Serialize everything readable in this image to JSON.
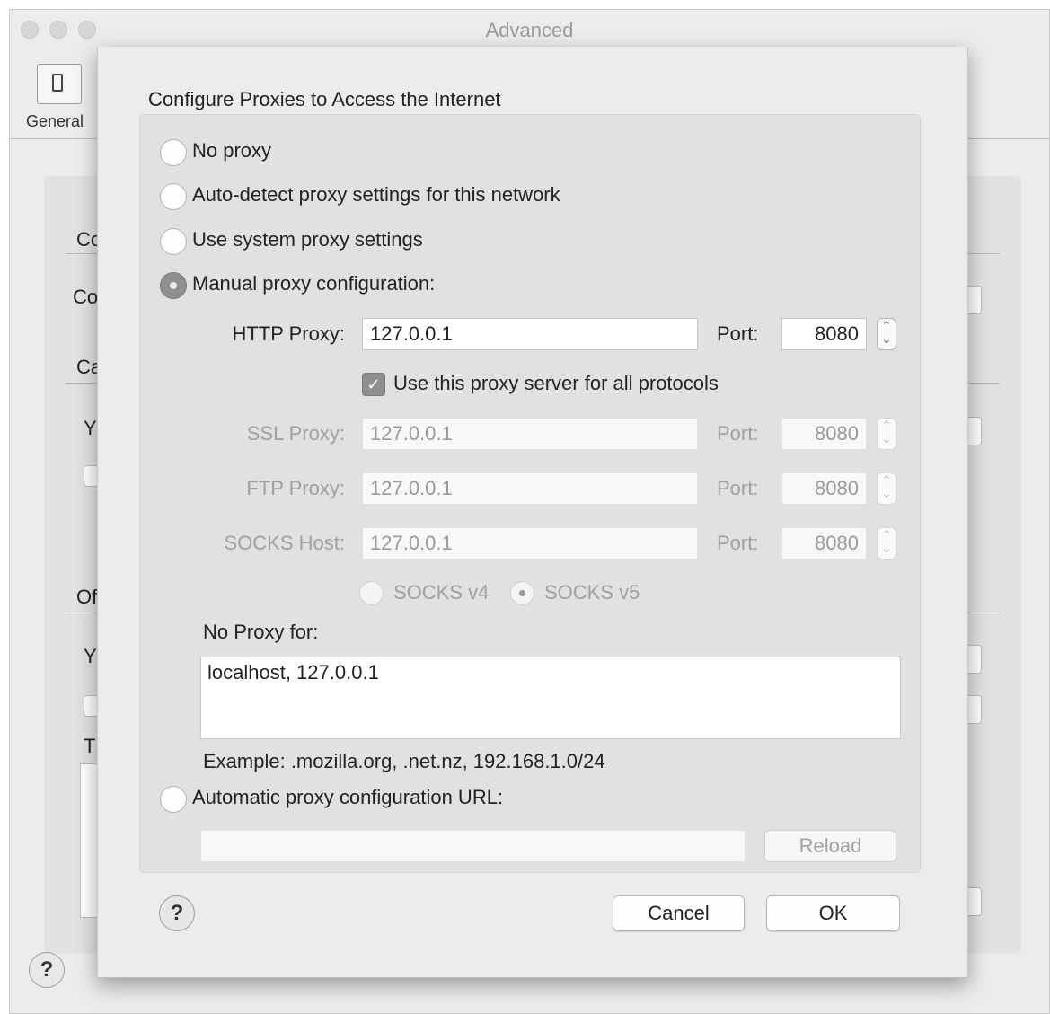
{
  "window": {
    "title": "Advanced",
    "toolbar": {
      "general_label": "General"
    },
    "background_fragments": [
      "Cc",
      "Co",
      "Ca",
      "Y",
      "Of",
      "Y",
      "T"
    ]
  },
  "dialog": {
    "title": "Configure Proxies to Access the Internet",
    "radios": {
      "no_proxy": "No proxy",
      "auto_detect": "Auto-detect proxy settings for this network",
      "system": "Use system proxy settings",
      "manual": "Manual proxy configuration:",
      "auto_url": "Automatic proxy configuration URL:"
    },
    "selected_mode": "manual",
    "http": {
      "label": "HTTP Proxy:",
      "value": "127.0.0.1",
      "port_label": "Port:",
      "port": "8080"
    },
    "use_for_all": {
      "label": "Use this proxy server for all protocols",
      "checked": true
    },
    "ssl": {
      "label": "SSL Proxy:",
      "value": "127.0.0.1",
      "port_label": "Port:",
      "port": "8080"
    },
    "ftp": {
      "label": "FTP Proxy:",
      "value": "127.0.0.1",
      "port_label": "Port:",
      "port": "8080"
    },
    "socks": {
      "label": "SOCKS Host:",
      "value": "127.0.0.1",
      "port_label": "Port:",
      "port": "8080"
    },
    "socks_version": {
      "v4": "SOCKS v4",
      "v5": "SOCKS v5",
      "selected": "v5"
    },
    "no_proxy_for": {
      "label": "No Proxy for:",
      "value": "localhost, 127.0.0.1"
    },
    "example": "Example: .mozilla.org, .net.nz, 192.168.1.0/24",
    "auto_url_value": "",
    "reload_label": "Reload",
    "cancel_label": "Cancel",
    "ok_label": "OK",
    "help_glyph": "?"
  }
}
